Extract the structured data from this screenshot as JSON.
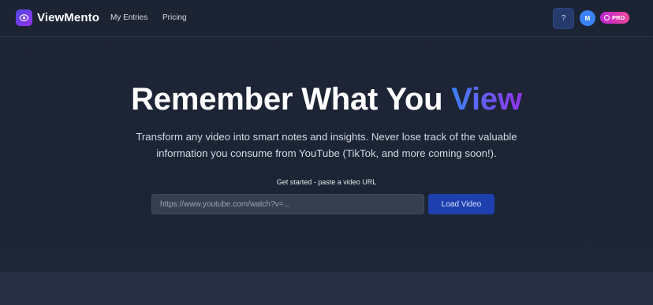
{
  "header": {
    "brand": "ViewMento",
    "nav": [
      {
        "label": "My Entries"
      },
      {
        "label": "Pricing"
      }
    ],
    "help_label": "?",
    "avatar_initial": "M",
    "pro_badge": "PRO"
  },
  "hero": {
    "title_main": "Remember What You ",
    "title_accent": "View",
    "subtitle": "Transform any video into smart notes and insights. Never lose track of the valuable information you consume from YouTube (TikTok, and more coming soon!).",
    "input_label": "Get started - paste a video URL",
    "input_placeholder": "https://www.youtube.com/watch?v=...",
    "input_value": "",
    "button_label": "Load Video"
  },
  "icons": {
    "logo": "eye-icon",
    "pro": "bolt-icon"
  },
  "colors": {
    "accent_gradient_start": "#3b82f6",
    "accent_gradient_end": "#9333ea",
    "primary_button": "#1e40af",
    "pro_badge": "#d946ef",
    "background": "#1b2333"
  }
}
